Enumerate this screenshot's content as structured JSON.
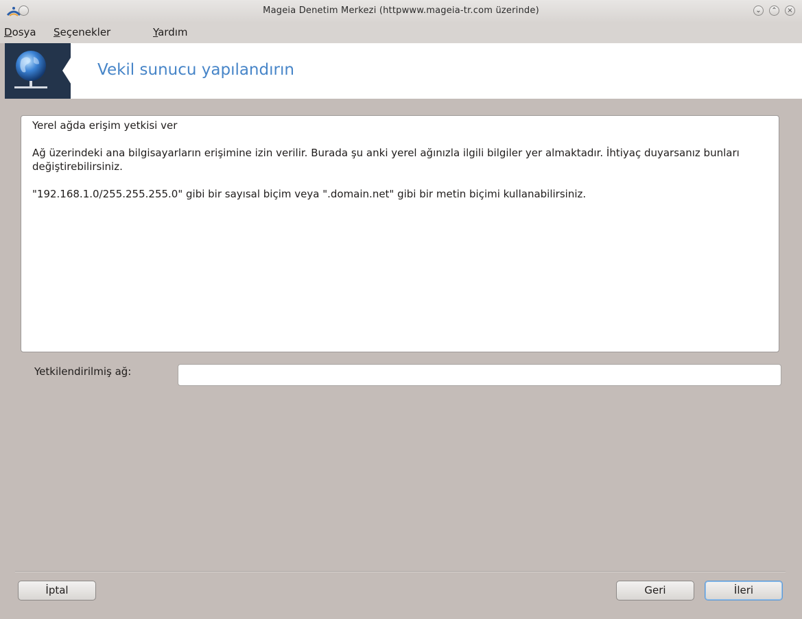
{
  "window": {
    "title": "Mageia Denetim Merkezi  (httpwww.mageia-tr.com üzerinde)",
    "controls": {
      "minimize": "⌄",
      "maximize": "⌃",
      "close": "×"
    }
  },
  "menubar": {
    "items": [
      {
        "label_first": "D",
        "label_rest": "osya"
      },
      {
        "label_first": "S",
        "label_rest": "eçenekler"
      },
      {
        "label_first": "Y",
        "label_rest": "ardım"
      }
    ]
  },
  "header": {
    "title": "Vekil sunucu yapılandırın",
    "icon": "network-globe-icon"
  },
  "content": {
    "heading": "Yerel ağda erişim yetkisi ver",
    "paragraph1": "Ağ üzerindeki ana bilgisayarların erişimine izin verilir. Burada şu anki yerel ağınızla ilgili bilgiler yer almaktadır. İhtiyaç duyarsanız bunları değiştirebilirsiniz.",
    "paragraph2": "\"192.168.1.0/255.255.255.0\" gibi bir sayısal biçim veya \".domain.net\" gibi bir metin biçimi kullanabilirsiniz."
  },
  "form": {
    "label": "Yetkilendirilmiş ağ:",
    "value": ""
  },
  "buttons": {
    "cancel": "İptal",
    "back": "Geri",
    "next": "İleri"
  },
  "colors": {
    "accent": "#4785c8",
    "header_dark": "#23344b",
    "background": "#c4bcb8"
  }
}
